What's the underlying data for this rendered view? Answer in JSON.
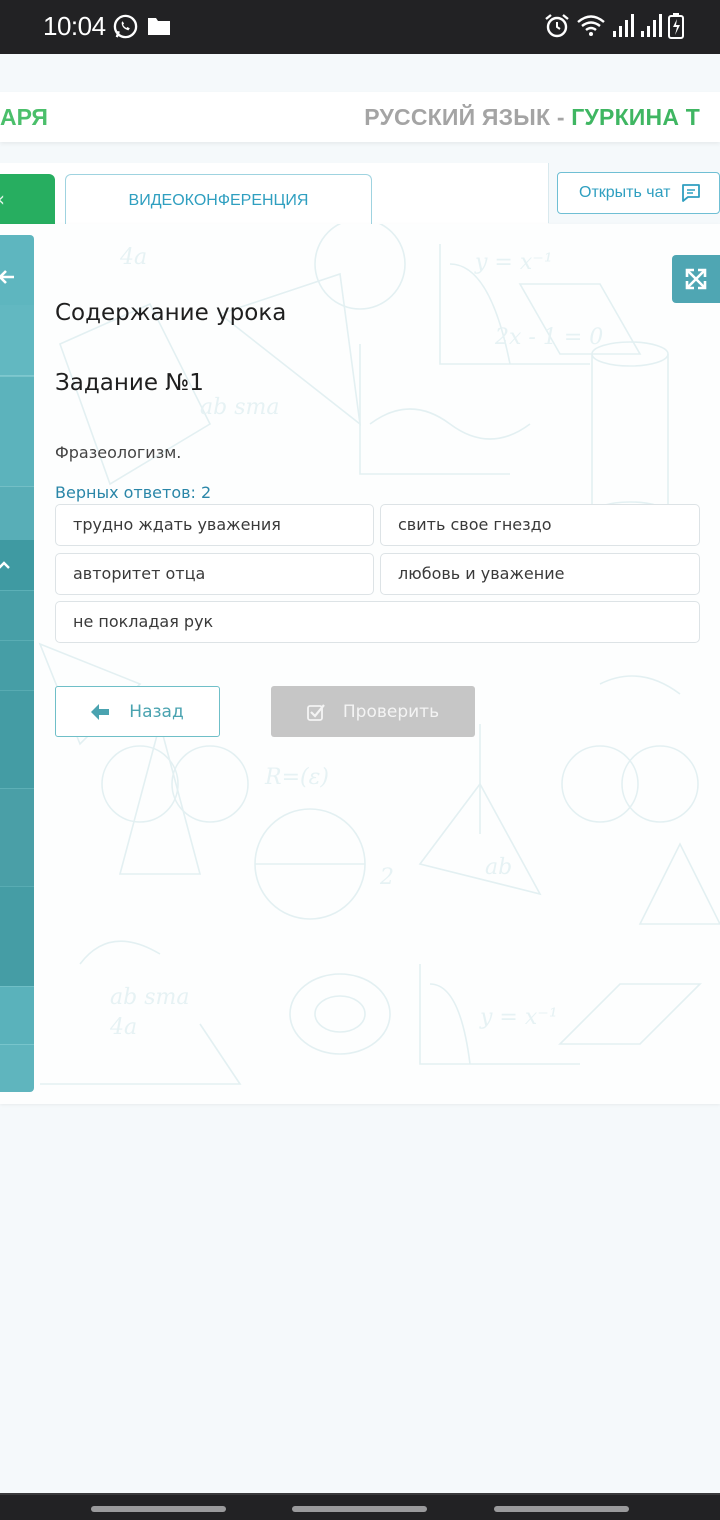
{
  "status_bar": {
    "time": "10:04",
    "icons": [
      "whatsapp-icon",
      "folder-icon",
      "alarm-icon",
      "wifi-icon",
      "signal-icon",
      "signal-icon",
      "battery-charging-icon"
    ]
  },
  "banner": {
    "left_text": "АРЯ",
    "subject": "РУССКИЙ ЯЗЫК - ",
    "teacher": "ГУРКИНА Т"
  },
  "tabs": {
    "video_label": "ВИДЕОКОНФЕРЕНЦИЯ",
    "chat_label": "Открыть чат"
  },
  "lesson": {
    "title": "Содержание урока",
    "task_title": "Задание №1",
    "task_text": "Фразеологизм.",
    "correct_count": "Верных ответов: 2",
    "options": [
      "трудно ждать уважения",
      "свить свое гнездо",
      "авторитет отца",
      "любовь и уважение",
      "не покладая рук"
    ]
  },
  "buttons": {
    "back_label": "Назад",
    "check_label": "Проверить"
  },
  "colors": {
    "accent_green": "#27ae60",
    "teal": "#4fa6b3",
    "link_blue": "#2f9fc0",
    "disabled_gray": "#c6c6c6"
  }
}
